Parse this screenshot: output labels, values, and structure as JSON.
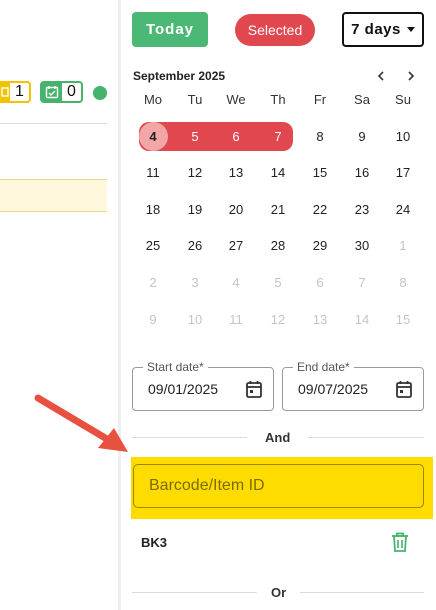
{
  "left_panel": {
    "yellow_badge_count": "1",
    "green_badge_count": "0",
    "colors": {
      "yellow": "#f2c400",
      "green": "#45b36b"
    }
  },
  "toolbar": {
    "today_label": "Today",
    "selected_label": "Selected",
    "range_label": "7 days"
  },
  "calendar": {
    "month_label": "September 2025",
    "weekdays": [
      "Mo",
      "Tu",
      "We",
      "Th",
      "Fr",
      "Sa",
      "Su"
    ],
    "weeks": [
      [
        "4",
        "5",
        "6",
        "7",
        "8",
        "9",
        "10"
      ],
      [
        "11",
        "12",
        "13",
        "14",
        "15",
        "16",
        "17"
      ],
      [
        "18",
        "19",
        "20",
        "21",
        "22",
        "23",
        "24"
      ],
      [
        "25",
        "26",
        "27",
        "28",
        "29",
        "30",
        "1"
      ],
      [
        "2",
        "3",
        "4",
        "5",
        "6",
        "7",
        "8"
      ],
      [
        "9",
        "10",
        "11",
        "12",
        "13",
        "14",
        "15"
      ]
    ],
    "range_color": "#e0474f"
  },
  "date_range": {
    "start_label": "Start date*",
    "start_value": "09/01/2025",
    "end_label": "End date*",
    "end_value": "09/07/2025"
  },
  "separators": {
    "and": "And",
    "or": "Or"
  },
  "barcode": {
    "placeholder": "Barcode/Item ID",
    "value": ""
  },
  "items": [
    {
      "code": "BK3"
    }
  ],
  "accent": {
    "today": "#4bb876",
    "selected": "#e0474f",
    "highlight": "#ffdc00",
    "arrow": "#e8513f"
  }
}
